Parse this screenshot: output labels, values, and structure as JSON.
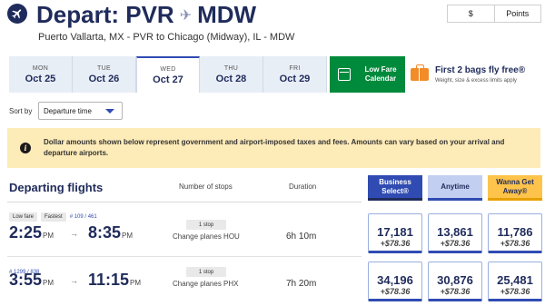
{
  "header": {
    "title_prefix": "Depart:",
    "origin": "PVR",
    "destination": "MDW",
    "route_description": "Puerto Vallarta, MX - PVR to Chicago (Midway), IL - MDW",
    "currency_options": [
      "$",
      "Points"
    ],
    "selected_currency": "Points"
  },
  "dates": [
    {
      "dow": "MON",
      "date": "Oct 25",
      "selected": false
    },
    {
      "dow": "TUE",
      "date": "Oct 26",
      "selected": false
    },
    {
      "dow": "WED",
      "date": "Oct 27",
      "selected": true
    },
    {
      "dow": "THU",
      "date": "Oct 28",
      "selected": false
    },
    {
      "dow": "FRI",
      "date": "Oct 29",
      "selected": false
    }
  ],
  "low_fare_calendar": {
    "label": "Low Fare Calendar"
  },
  "bags_promo": {
    "title": "First 2 bags fly free®",
    "subtitle": "Weight, size & excess limits apply"
  },
  "sort": {
    "label": "Sort by",
    "value": "Departure time"
  },
  "notice": {
    "text": "Dollar amounts shown below represent government and airport-imposed taxes and fees. Amounts can vary based on your arrival and departure airports."
  },
  "table": {
    "title": "Departing flights",
    "columns": {
      "stops": "Number of stops",
      "duration": "Duration"
    },
    "fare_classes": [
      {
        "label": "Business Select®",
        "color": "#304cb2"
      },
      {
        "label": "Anytime",
        "color": "#c3cff0"
      },
      {
        "label": "Wanna Get Away®",
        "color": "#fdc34b"
      }
    ]
  },
  "flights": [
    {
      "badges": [
        "Low fare",
        "Fastest"
      ],
      "flight_numbers": "# 109 / 461",
      "depart_time": "2:25",
      "depart_ampm": "PM",
      "arrive_time": "8:35",
      "arrive_ampm": "PM",
      "stops": "1 stop",
      "change": "Change planes HOU",
      "duration": "6h 10m",
      "fares": [
        {
          "points": "17,181",
          "tax": "+$78.36"
        },
        {
          "points": "13,861",
          "tax": "+$78.36"
        },
        {
          "points": "11,786",
          "tax": "+$78.36"
        }
      ]
    },
    {
      "badges": [],
      "flight_numbers": "# 1299 / 838",
      "depart_time": "3:55",
      "depart_ampm": "PM",
      "arrive_time": "11:15",
      "arrive_ampm": "PM",
      "stops": "1 stop",
      "change": "Change planes PHX",
      "duration": "7h 20m",
      "fares": [
        {
          "points": "34,196",
          "tax": "+$78.36"
        },
        {
          "points": "30,876",
          "tax": "+$78.36"
        },
        {
          "points": "25,481",
          "tax": "+$78.36"
        }
      ]
    }
  ],
  "icons": {
    "plane": "plane-icon",
    "calendar": "calendar-icon",
    "bag": "suitcase-icon",
    "info": "info-icon",
    "arrow": "arrow-right-icon"
  }
}
